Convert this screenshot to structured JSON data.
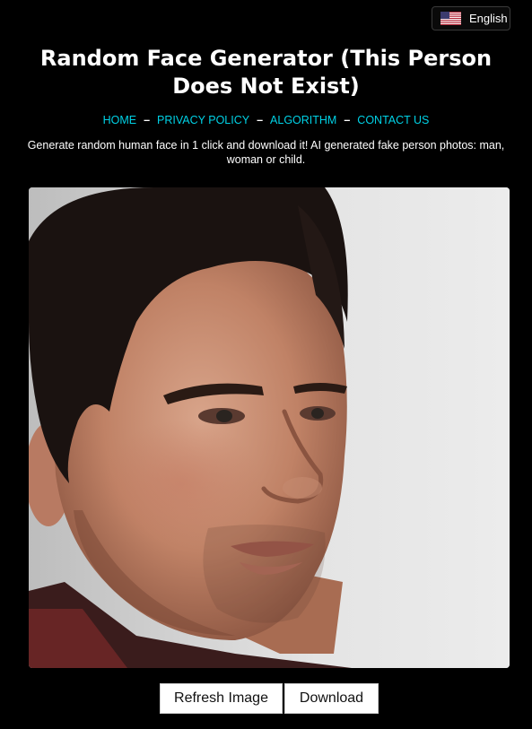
{
  "language": {
    "label": "English",
    "icon": "us-flag-icon"
  },
  "header": {
    "title": "Random Face Generator (This Person Does Not Exist)"
  },
  "nav": {
    "items": [
      {
        "label": "HOME"
      },
      {
        "label": "PRIVACY POLICY"
      },
      {
        "label": "ALGORITHM"
      },
      {
        "label": "CONTACT US"
      }
    ],
    "separator": "–"
  },
  "tagline": "Generate random human face in 1 click and download it! AI generated fake person photos: man, woman or child.",
  "actions": {
    "refresh_label": "Refresh Image",
    "download_label": "Download"
  },
  "colors": {
    "background": "#000000",
    "link": "#00d2e6",
    "text": "#ffffff",
    "button_bg": "#ffffff"
  }
}
